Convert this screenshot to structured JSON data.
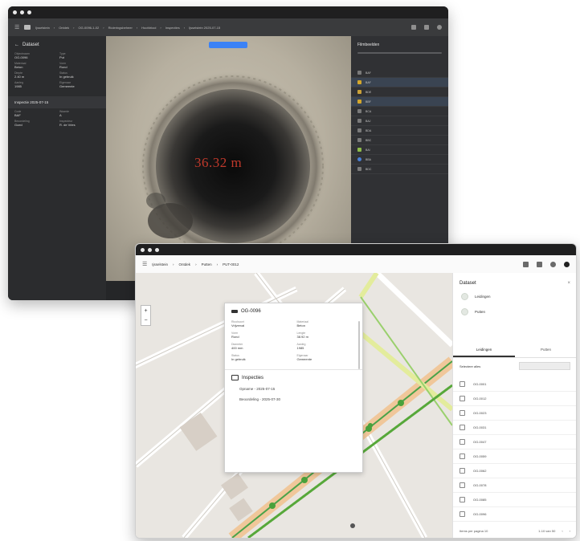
{
  "dark_window": {
    "breadcrumbs": [
      "Ijsselstein",
      "Ontdek",
      "OG-0096-1-02",
      "Rioleringsbeheer",
      "Hoofdriool",
      "Inspecties",
      "Ijsselstein 2025-07-15"
    ],
    "left_panel": {
      "title": "Dataset",
      "fields": [
        {
          "k": "Objectnaam",
          "v": "OG-0096"
        },
        {
          "k": "Type",
          "v": "Put"
        },
        {
          "k": "Materiaal",
          "v": "Beton"
        },
        {
          "k": "Vorm",
          "v": "Rond"
        },
        {
          "k": "Diepte",
          "v": "2.40 m"
        },
        {
          "k": "Status",
          "v": "In gebruik"
        },
        {
          "k": "Aanleg",
          "v": "1985"
        },
        {
          "k": "Eigenaar",
          "v": "Gemeente"
        }
      ],
      "section_title": "Inspectie 2025-07-15",
      "section_fields": [
        {
          "k": "Code",
          "v": "BAF"
        },
        {
          "k": "Waarde",
          "v": "A"
        },
        {
          "k": "Beoordeling",
          "v": "Goed"
        },
        {
          "k": "Inspecteur",
          "v": "R. de Vries"
        }
      ]
    },
    "photo_overlay": "36.32 m",
    "right_panel": {
      "title": "Filmbeelden",
      "rows": [
        "BAF",
        "BAF",
        "BDE",
        "BBF",
        "BCA",
        "BAJ",
        "BDA",
        "BBC",
        "BAI",
        "BBA",
        "BDC"
      ]
    }
  },
  "light_window": {
    "breadcrumbs": [
      "Ijsselstein",
      "Ontdek",
      "Putten",
      "PUT-0012"
    ],
    "popup": {
      "title": "OG-0096",
      "fields": [
        {
          "k": "Rioolsoort",
          "v": "Vrijverval"
        },
        {
          "k": "Materiaal",
          "v": "Beton"
        },
        {
          "k": "Vorm",
          "v": "Rond"
        },
        {
          "k": "Lengte",
          "v": "38.92 m"
        },
        {
          "k": "Diameter",
          "v": "400 mm"
        },
        {
          "k": "Aanleg",
          "v": "1985"
        },
        {
          "k": "Status",
          "v": "In gebruik"
        },
        {
          "k": "Eigenaar",
          "v": "Gemeente"
        }
      ],
      "inspections_title": "Inspecties",
      "inspections": [
        "Opname - 2025-07-15",
        "Beoordeling - 2025-07-30"
      ]
    },
    "side_panel": {
      "title": "Dataset",
      "options": [
        "Leidingen",
        "Putten"
      ],
      "tabs": [
        "Leidingen",
        "Putten"
      ],
      "list_label": "Selecteer alles",
      "items": [
        "OG-0001",
        "OG-0012",
        "OG-0023",
        "OG-0031",
        "OG-0047",
        "OG-0059",
        "OG-0062",
        "OG-0078",
        "OG-0085",
        "OG-0096"
      ],
      "footer_left": "Items per pagina 10",
      "footer_right": "1-10 van 50"
    }
  }
}
